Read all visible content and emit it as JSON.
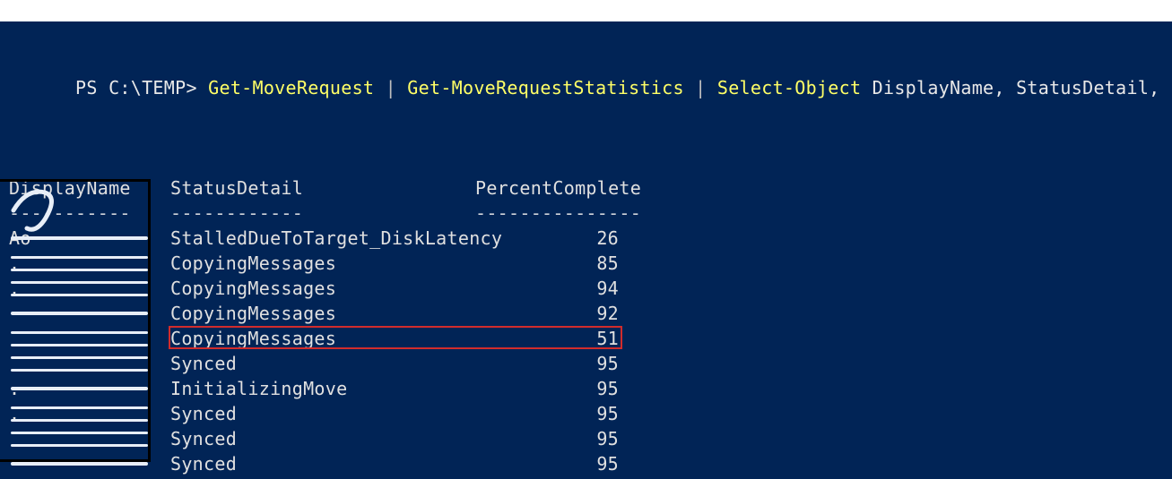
{
  "prompt": "PS C:\\TEMP> ",
  "command": {
    "c1": "Get-MoveRequest",
    "pipe": " | ",
    "c2": "Get-MoveRequestStatistics",
    "c3": "Select-Object",
    "params": " DisplayName, StatusDetail, PercentComplete"
  },
  "columns": {
    "name": "DisplayName",
    "status": "StatusDetail",
    "pct": "PercentComplete"
  },
  "underline": {
    "name": "-----------",
    "status": "------------",
    "pct": "---------------"
  },
  "rows": [
    {
      "name": "       Ao",
      "status": "StalledDueToTarget_DiskLatency",
      "pct": "26",
      "highlight": false
    },
    {
      "name": "              .",
      "status": "CopyingMessages",
      "pct": "85",
      "highlight": false
    },
    {
      "name": "              .",
      "status": "CopyingMessages",
      "pct": "94",
      "highlight": false
    },
    {
      "name": "              ",
      "status": "CopyingMessages",
      "pct": "92",
      "highlight": false
    },
    {
      "name": "              ",
      "status": "CopyingMessages",
      "pct": "51",
      "highlight": true
    },
    {
      "name": "          ",
      "status": "Synced",
      "pct": "95",
      "highlight": false
    },
    {
      "name": "              .",
      "status": "InitializingMove",
      "pct": "95",
      "highlight": false
    },
    {
      "name": "              .",
      "status": "Synced",
      "pct": "95",
      "highlight": false
    },
    {
      "name": "              ",
      "status": "Synced",
      "pct": "95",
      "highlight": false
    },
    {
      "name": "              ",
      "status": "Synced",
      "pct": "95",
      "highlight": false
    }
  ]
}
